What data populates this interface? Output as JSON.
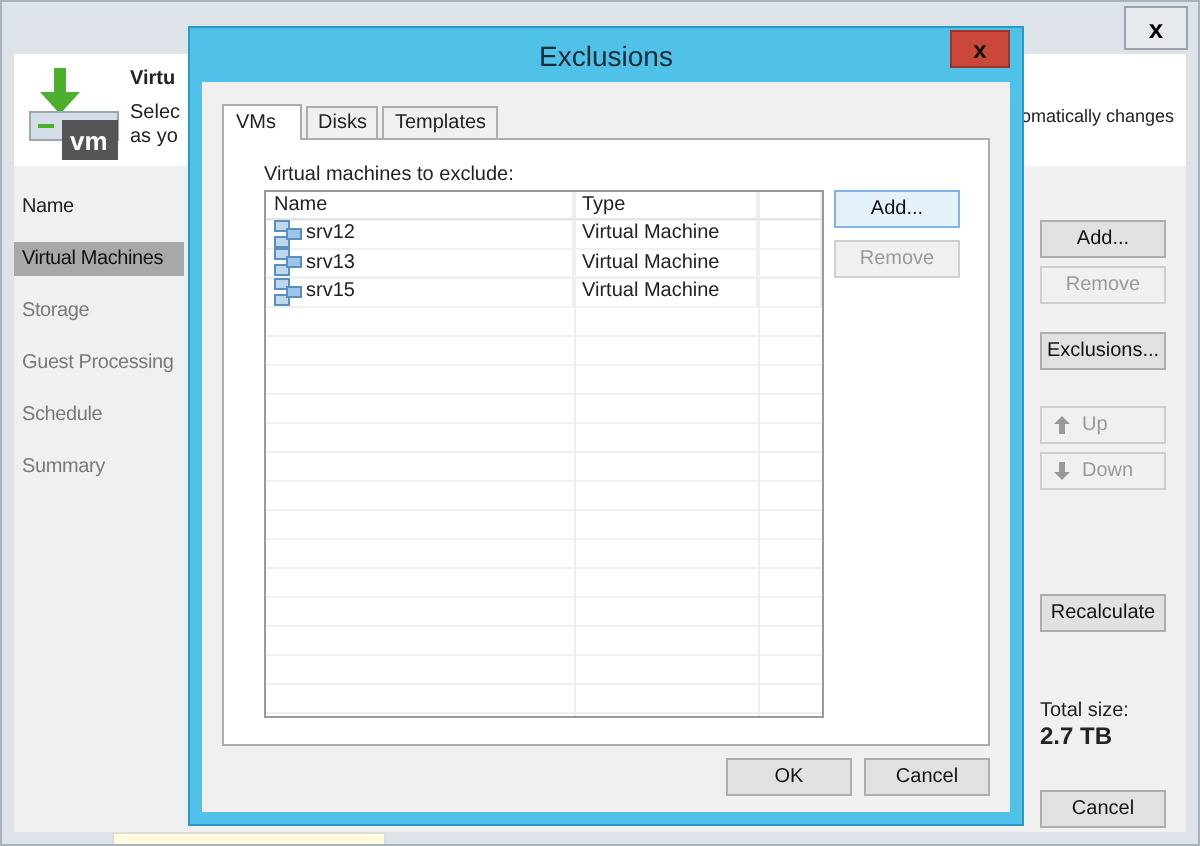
{
  "window": {
    "close": "x"
  },
  "header": {
    "icon_label": "vm",
    "title": "Virtu",
    "lines": [
      "Selec",
      "as yo"
    ],
    "right_text": "omatically changes"
  },
  "steps": [
    {
      "label": "Name",
      "selected": false,
      "disabled": false
    },
    {
      "label": "Virtual Machines",
      "selected": true,
      "disabled": false
    },
    {
      "label": "Storage",
      "selected": false,
      "disabled": true
    },
    {
      "label": "Guest Processing",
      "selected": false,
      "disabled": true
    },
    {
      "label": "Schedule",
      "selected": false,
      "disabled": true
    },
    {
      "label": "Summary",
      "selected": false,
      "disabled": true
    }
  ],
  "side_buttons": [
    {
      "label": "Add...",
      "kind": "plain",
      "disabled": false
    },
    {
      "label": "Remove",
      "kind": "plain",
      "disabled": true
    },
    {
      "label": "Exclusions...",
      "kind": "plain",
      "disabled": false
    },
    {
      "label": "Up",
      "kind": "up",
      "disabled": true
    },
    {
      "label": "Down",
      "kind": "down",
      "disabled": true
    },
    {
      "label": "Recalculate",
      "kind": "plain",
      "disabled": false
    }
  ],
  "total": {
    "label": "Total size:",
    "value": "2.7 TB"
  },
  "footer_buttons": [
    "Cancel"
  ],
  "dialog": {
    "title": "Exclusions",
    "close": "x",
    "tabs": [
      {
        "label": "VMs",
        "selected": true
      },
      {
        "label": "Disks",
        "selected": false
      },
      {
        "label": "Templates",
        "selected": false
      }
    ],
    "list_label": "Virtual machines to exclude:",
    "columns": [
      "Name",
      "Type"
    ],
    "rows": [
      {
        "name": "srv12",
        "type": "Virtual Machine"
      },
      {
        "name": "srv13",
        "type": "Virtual Machine"
      },
      {
        "name": "srv15",
        "type": "Virtual Machine"
      }
    ],
    "buttons": [
      {
        "label": "Add...",
        "disabled": false
      },
      {
        "label": "Remove",
        "disabled": true
      }
    ],
    "footer": [
      "OK",
      "Cancel"
    ]
  }
}
